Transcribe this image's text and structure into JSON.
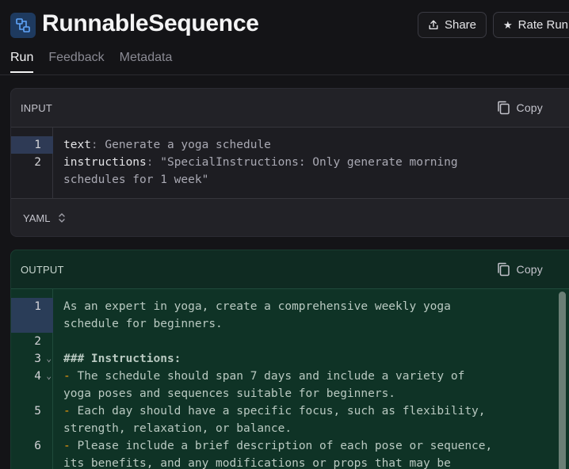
{
  "header": {
    "title": "RunnableSequence",
    "share_label": "Share",
    "rate_label": "Rate Run"
  },
  "tabs": [
    {
      "label": "Run",
      "active": true
    },
    {
      "label": "Feedback",
      "active": false
    },
    {
      "label": "Metadata",
      "active": false
    }
  ],
  "input": {
    "heading": "INPUT",
    "copy_label": "Copy",
    "format": "YAML",
    "lines": [
      {
        "num": "1",
        "key": "text",
        "value": " Generate a yoga schedule"
      },
      {
        "num": "2",
        "key": "instructions",
        "value": " \"SpecialInstructions: Only generate morning",
        "cont": "schedules for 1 week\""
      }
    ]
  },
  "output": {
    "heading": "OUTPUT",
    "copy_label": "Copy",
    "lines": [
      {
        "num": "1",
        "text": "As an expert in yoga, create a comprehensive weekly yoga",
        "cont": "schedule for beginners."
      },
      {
        "num": "2",
        "text": ""
      },
      {
        "num": "3",
        "text": "### Instructions:"
      },
      {
        "num": "4",
        "bullet": "-",
        "text": " The schedule should span 7 days and include a variety of",
        "cont": "yoga poses and sequences suitable for beginners."
      },
      {
        "num": "5",
        "bullet": "-",
        "text": " Each day should have a specific focus, such as flexibility,",
        "cont": "strength, relaxation, or balance."
      },
      {
        "num": "6",
        "bullet": "-",
        "text": " Please include a brief description of each pose or sequence,",
        "cont": "its benefits, and any modifications or props that may be"
      }
    ]
  },
  "colors": {
    "accent": "#7dd3fc",
    "output_bg": "#0f3326",
    "bullet": "#f59e0b"
  }
}
